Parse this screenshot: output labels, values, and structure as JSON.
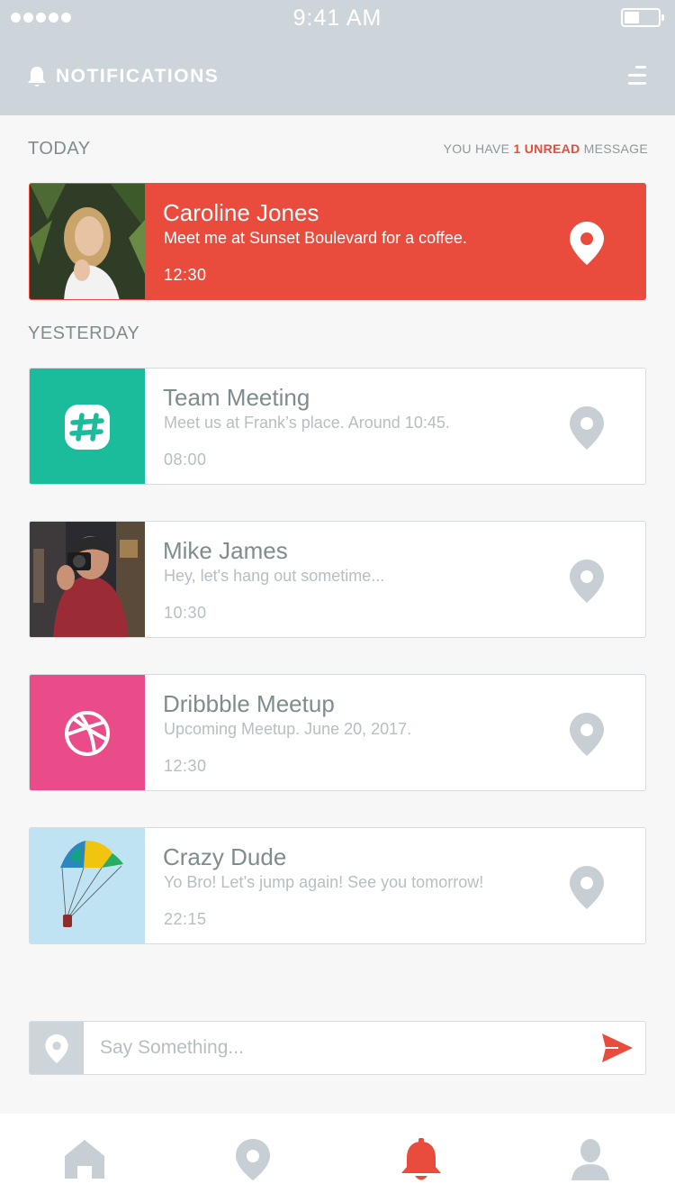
{
  "status_bar": {
    "time": "9:41 AM"
  },
  "header": {
    "title": "NOTIFICATIONS",
    "icon": "bell-icon",
    "menu_icon": "menu-icon"
  },
  "sections": {
    "today": "TODAY",
    "yesterday": "YESTERDAY",
    "unread_prefix": "YOU HAVE",
    "unread_count": "1 UNREAD",
    "unread_suffix": "MESSAGE"
  },
  "notifications": [
    {
      "name": "Caroline Jones",
      "message": "Meet me at Sunset Boulevard for a coffee.",
      "time": "12:30",
      "unread": true,
      "thumb": "photo-woman"
    },
    {
      "name": "Team Meeting",
      "message": "Meet us at Frank’s place. Around 10:45.",
      "time": "08:00",
      "unread": false,
      "thumb": "slack-icon"
    },
    {
      "name": "Mike James",
      "message": "Hey, let's hang out sometime...",
      "time": "10:30",
      "unread": false,
      "thumb": "photo-photographer"
    },
    {
      "name": "Dribbble Meetup",
      "message": "Upcoming Meetup. June 20, 2017.",
      "time": "12:30",
      "unread": false,
      "thumb": "dribbble-icon"
    },
    {
      "name": "Crazy Dude",
      "message": "Yo Bro! Let’s jump again! See you tomorrow!",
      "time": "22:15",
      "unread": false,
      "thumb": "photo-parasail"
    }
  ],
  "compose": {
    "placeholder": "Say Something...",
    "send_icon": "send-icon"
  },
  "tabbar": [
    {
      "name": "home",
      "icon": "home-icon",
      "active": false
    },
    {
      "name": "location",
      "icon": "location-pin-icon",
      "active": false
    },
    {
      "name": "notifications",
      "icon": "bell-icon",
      "active": true
    },
    {
      "name": "profile",
      "icon": "user-icon",
      "active": false
    }
  ],
  "colors": {
    "accent": "#e94b3c",
    "header_bg": "#cdd5da",
    "slack_green": "#1abc9c",
    "dribbble_pink": "#ea4c89",
    "muted_text": "#b6bec2",
    "primary_text": "#7f8c8d",
    "inactive_icon": "#c7cfd4"
  }
}
